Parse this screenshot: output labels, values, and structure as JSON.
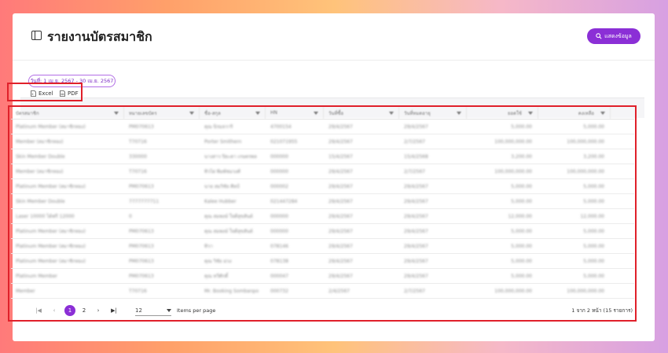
{
  "header": {
    "title": "รายงานบัตรสมาชิก",
    "show_button": "แสดงข้อมูล"
  },
  "filter": {
    "date_range": "วันที่: 1 เม.ย. 2567 - 30 เม.ย. 2567"
  },
  "export": {
    "excel": "Excel",
    "pdf": "PDF"
  },
  "table": {
    "columns": [
      "บัตรสมาชิก",
      "หมายเลขบัตร",
      "ชื่อ-สกุล",
      "HN",
      "วันที่ซื้อ",
      "วันที่หมดอายุ",
      "ยอดใช้",
      "คงเหลือ"
    ],
    "rows": [
      [
        "Platinum Member (สมาชิกทอง)",
        "PM070613",
        "คุณ นิรมลวาริ",
        "4700154",
        "29/4/2567",
        "29/4/2567",
        "5,000.00",
        "5,000.00"
      ],
      [
        "Member (สมาชิกทอง)",
        "T70716",
        "Porter Smithern",
        "021071955",
        "29/4/2567",
        "2/7/2567",
        "100,000,000.00",
        "100,000,000.00"
      ],
      [
        "Skin Member Double",
        "330000",
        "นางสาว ปิยะดา เกษตรพล",
        "000000",
        "15/4/2567",
        "15/4/2568",
        "3,200.00",
        "3,200.00"
      ],
      [
        "Member (สมาชิกทอง)",
        "T70716",
        "ทิวไผ่ พิมพ์ชมวงศ์",
        "000000",
        "29/4/2567",
        "2/7/2567",
        "100,000,000.00",
        "100,000,000.00"
      ],
      [
        "Platinum Member (สมาชิกทอง)",
        "PM070613",
        "นาย สมวิชัย ศิลป์",
        "000002",
        "29/4/2567",
        "29/4/2567",
        "5,000.00",
        "5,000.00"
      ],
      [
        "Skin Member Double",
        "7777777711",
        "Kalee Hubber",
        "021447284",
        "29/4/2567",
        "29/4/2567",
        "5,000.00",
        "5,000.00"
      ],
      [
        "Laser 10000 ได้ฟรี 12000",
        "0",
        "คุณ สมพงษ์ ใจดีสุขสันต์",
        "000000",
        "29/4/2567",
        "29/4/2567",
        "12,000.00",
        "12,000.00"
      ],
      [
        "Platinum Member (สมาชิกทอง)",
        "PM070613",
        "คุณ สมพงษ์ ใจดีสุขสันต์",
        "000000",
        "29/4/2567",
        "29/4/2567",
        "5,000.00",
        "5,000.00"
      ],
      [
        "Platinum Member (สมาชิกทอง)",
        "PM070613",
        "ทิวา",
        "078146",
        "29/4/2567",
        "29/4/2567",
        "5,000.00",
        "5,000.00"
      ],
      [
        "Platinum Member (สมาชิกทอง)",
        "PM070613",
        "คุณ วิชัย ม่วง",
        "078138",
        "29/4/2567",
        "29/4/2567",
        "5,000.00",
        "5,000.00"
      ],
      [
        "Platinum Member",
        "PM070613",
        "คุณ ทวีศักดิ์",
        "000047",
        "29/4/2567",
        "29/4/2567",
        "5,000.00",
        "5,000.00"
      ],
      [
        "Member",
        "T70716",
        "Mr. Booking Sombanpo",
        "000732",
        "2/4/2567",
        "2/7/2567",
        "100,000,000.00",
        "100,000,000.00"
      ]
    ]
  },
  "pager": {
    "first": "|◀",
    "prev": "‹",
    "pages": [
      "1",
      "2"
    ],
    "next": "›",
    "last": "▶|",
    "per_page": "12",
    "items_per_page": "Items per page",
    "range_text": "1 จาก 2 หน้า (15 รายการ)"
  },
  "colors": {
    "accent": "#8b2fd6",
    "highlight": "#e0202a"
  }
}
